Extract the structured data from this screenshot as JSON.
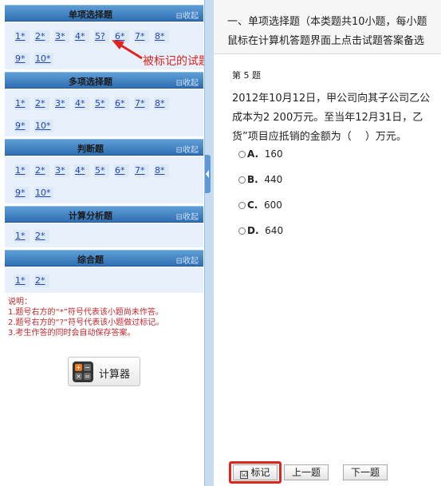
{
  "sections": [
    {
      "title": "单项选择题",
      "collapse": "收起",
      "rows": [
        [
          "1*",
          "2*",
          "3*",
          "4*",
          "5?",
          "6*",
          "7*",
          "8*"
        ],
        [
          "9*",
          "10*"
        ]
      ]
    },
    {
      "title": "多项选择题",
      "collapse": "收起",
      "rows": [
        [
          "1*",
          "2*",
          "3*",
          "4*",
          "5*",
          "6*",
          "7*",
          "8*"
        ],
        [
          "9*",
          "10*"
        ]
      ]
    },
    {
      "title": "判断题",
      "collapse": "收起",
      "rows": [
        [
          "1*",
          "2*",
          "3*",
          "4*",
          "5*",
          "6*",
          "7*",
          "8*"
        ],
        [
          "9*",
          "10*"
        ]
      ]
    },
    {
      "title": "计算分析题",
      "collapse": "收起",
      "rows": [
        [
          "1*",
          "2*"
        ]
      ]
    },
    {
      "title": "综合题",
      "collapse": "收起",
      "rows": [
        [
          "1*",
          "2*"
        ]
      ]
    }
  ],
  "notes": {
    "title": "说明：",
    "line1": "1.题号右方的“*”符号代表该小题尚未作答。",
    "line2": "2.题号右方的“?”符号代表该小题做过标记。",
    "line3": "3.考生作答的同时会自动保存答案。"
  },
  "calculator": {
    "label": "计算器",
    "keys": [
      "+",
      "−",
      "×",
      "="
    ]
  },
  "annotation": "被标记的试题",
  "instructions": {
    "line1": "一、单项选择题（本类题共10小题，每小题",
    "line2": "鼠标在计算机答题界面上点击试题答案备选"
  },
  "question": {
    "number": "第 5 题",
    "line1": "2012年10月12日，甲公司向其子公司乙公",
    "line2": "成本为2 200万元。至当年12月31日，乙",
    "line3": "货”项目应抵销的金额为（　 ）万元。",
    "options": [
      {
        "letter": "A.",
        "value": "160"
      },
      {
        "letter": "B.",
        "value": "440"
      },
      {
        "letter": "C.",
        "value": "600"
      },
      {
        "letter": "D.",
        "value": "640"
      }
    ]
  },
  "footer": {
    "mark": "标记",
    "mark_check": "☑",
    "prev": "上一题",
    "next": "下一题"
  },
  "colors": {
    "header_blue": "#2f6fb3",
    "panel_bg": "#e8f1fb",
    "annotation_red": "#e0241b",
    "link_blue": "#2444b8"
  }
}
